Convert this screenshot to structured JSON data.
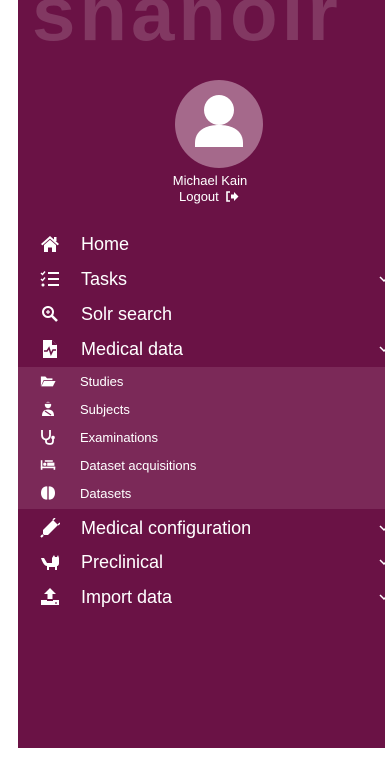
{
  "app": {
    "logo_text": "shanoir"
  },
  "user": {
    "name": "Michael Kain",
    "logout_label": "Logout"
  },
  "menu": {
    "home": "Home",
    "tasks": "Tasks",
    "solr_search": "Solr search",
    "medical_data": "Medical data",
    "medical_configuration": "Medical configuration",
    "preclinical": "Preclinical",
    "import_data": "Import data"
  },
  "submenu": {
    "studies": "Studies",
    "subjects": "Subjects",
    "examinations": "Examinations",
    "dataset_acquisitions": "Dataset acquisitions",
    "datasets": "Datasets"
  },
  "colors": {
    "sidebar_bg": "#6a1245",
    "submenu_bg": "#7b2958",
    "avatar_bg": "#a5698b",
    "text": "#ffffff"
  },
  "icons": {
    "home": "home-icon",
    "tasks": "tasks-list-icon",
    "solr_search": "search-icon",
    "medical_data": "medical-file-icon",
    "studies": "folder-open-icon",
    "subjects": "user-injured-icon",
    "examinations": "stethoscope-icon",
    "dataset_acquisitions": "procedure-bed-icon",
    "datasets": "brain-icon",
    "medical_configuration": "syringe-icon",
    "preclinical": "lab-animal-icon",
    "import_data": "upload-icon"
  }
}
